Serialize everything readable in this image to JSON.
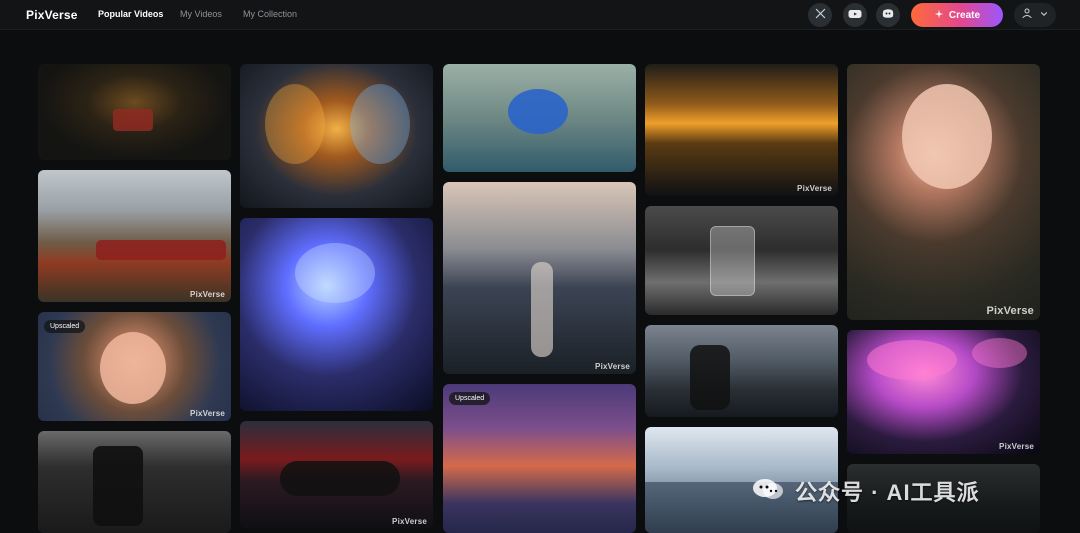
{
  "header": {
    "logo": "PixVerse",
    "tabs": [
      {
        "label": "Popular Videos",
        "active": true
      },
      {
        "label": "My Videos",
        "active": false
      },
      {
        "label": "My Collection",
        "active": false
      }
    ],
    "create_label": "Create"
  },
  "icons": {
    "x": "x-icon",
    "youtube": "youtube-icon",
    "discord": "discord-icon",
    "create": "sparkle-icon",
    "user": "user-icon",
    "chevron": "chevron-down-icon"
  },
  "colors": {
    "background": "#0b0d0f",
    "topbar": "#121416",
    "create_gradient_start": "#ff6a3a",
    "create_gradient_mid": "#e2478f",
    "create_gradient_end": "#9b57ff"
  },
  "gallery": {
    "watermark": "PixVerse",
    "badge": "Upscaled"
  },
  "footer_watermark": {
    "text": "公众号 · AI工具派"
  }
}
